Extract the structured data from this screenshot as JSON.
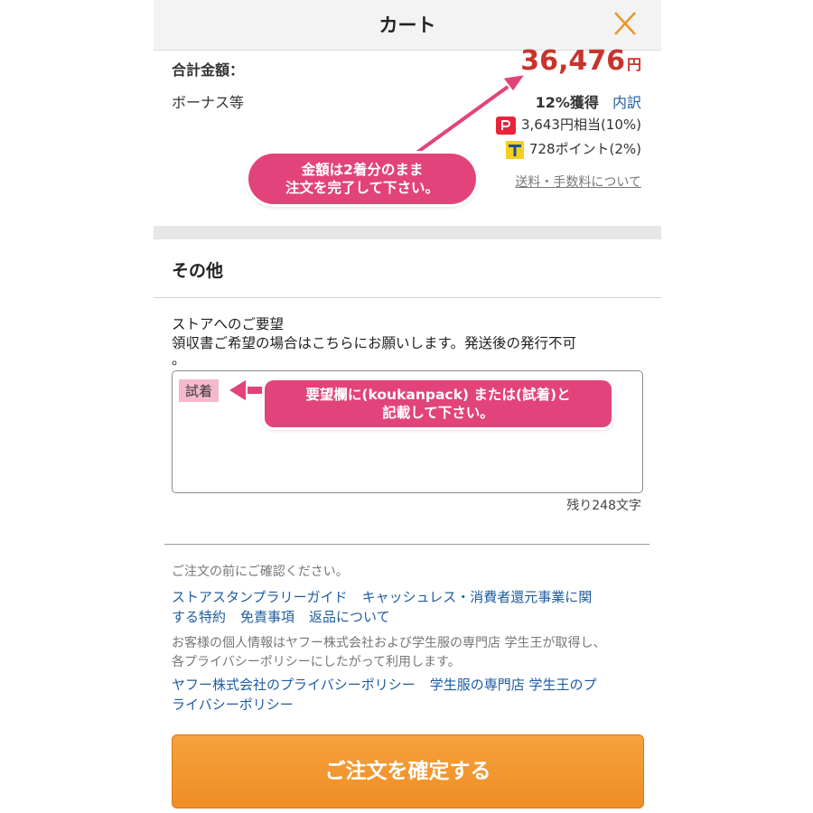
{
  "header": {
    "title": "カート"
  },
  "summary": {
    "total_label": "合計金額：",
    "total_value": "36,476",
    "total_unit": "円",
    "bonus_label": "ボーナス等",
    "bonus_value": "12%獲得",
    "bonus_link": "内訳",
    "paypay_line": "3,643円相当(10%)",
    "tpoint_line": "728ポイント(2%)",
    "shipping_link": "送料・手数料について"
  },
  "other": {
    "section_title": "その他",
    "request_label_line1": "ストアへのご要望",
    "request_label_line2": "領収書ご希望の場合はこちらにお願いします。発送後の発行不可",
    "request_label_line3": "。",
    "request_value": "試着",
    "remaining": "残り248文字"
  },
  "confirm_section": {
    "notice": "ご注文の前にご確認ください。",
    "links_row1": [
      "ストアスタンプラリーガイド",
      "キャッシュレス・消費者還元事業に関"
    ],
    "links_row2": [
      "する特約",
      "免責事項",
      "返品について"
    ],
    "privacy_line1": "お客様の個人情報はヤフー株式会社および学生服の専門店 学生王が取得し、",
    "privacy_line2": "各プライバシーポリシーにしたがって利用します。",
    "privacy_links_row1": [
      "ヤフー株式会社のプライバシーポリシー",
      "学生服の専門店 学生王のプ"
    ],
    "privacy_links_row2": "ライバシーポリシー",
    "button": "ご注文を確定する"
  },
  "annotations": {
    "amount_note_line1": "金額は2着分のまま",
    "amount_note_line2": "注文を完了して下さい。",
    "request_note_line1": "要望欄に(koukanpack) または(試着)と",
    "request_note_line2": "記載して下さい。"
  },
  "colors": {
    "price": "#c8342c",
    "link": "#1f5c9f",
    "button": "#f19530",
    "annotation": "#e2437a",
    "close_icon": "#e8972c"
  }
}
